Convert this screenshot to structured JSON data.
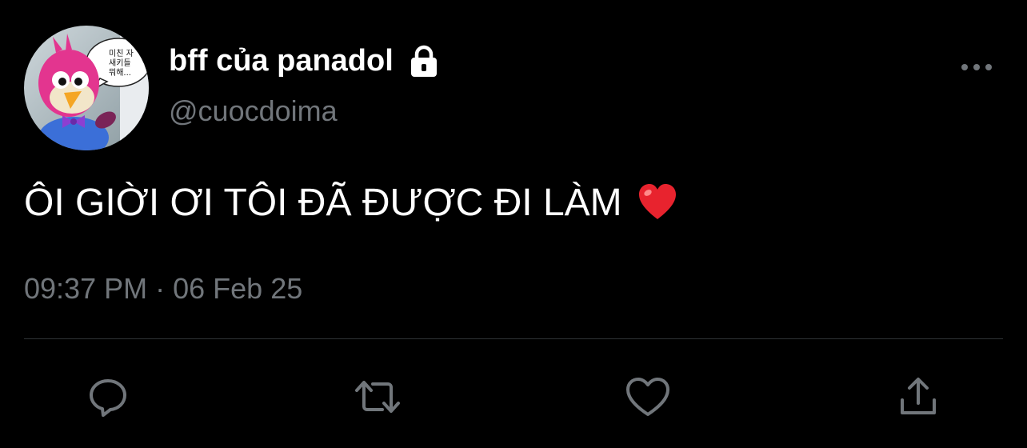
{
  "author": {
    "display_name": "bff của panadol",
    "handle": "@cuocdoima",
    "protected_icon": "lock-icon",
    "avatar_speech_text": [
      "미친 자",
      "새키들",
      "뭐해..."
    ]
  },
  "tweet": {
    "text": "ÔI GIỜI ƠI TÔI ĐÃ ĐƯỢC ĐI LÀM",
    "emoji": "red-heart-emoji",
    "time": "09:37 PM",
    "separator": "·",
    "date": "06 Feb 25"
  },
  "actions": [
    {
      "name": "reply",
      "icon": "reply-icon"
    },
    {
      "name": "retweet",
      "icon": "retweet-icon"
    },
    {
      "name": "like",
      "icon": "heart-icon"
    },
    {
      "name": "share",
      "icon": "share-icon"
    }
  ],
  "menu": {
    "icon": "more-icon"
  },
  "colors": {
    "background": "#000000",
    "primary_text": "#ffffff",
    "secondary_text": "#71767b",
    "divider": "#2f3336",
    "heart": "#e0245e"
  }
}
